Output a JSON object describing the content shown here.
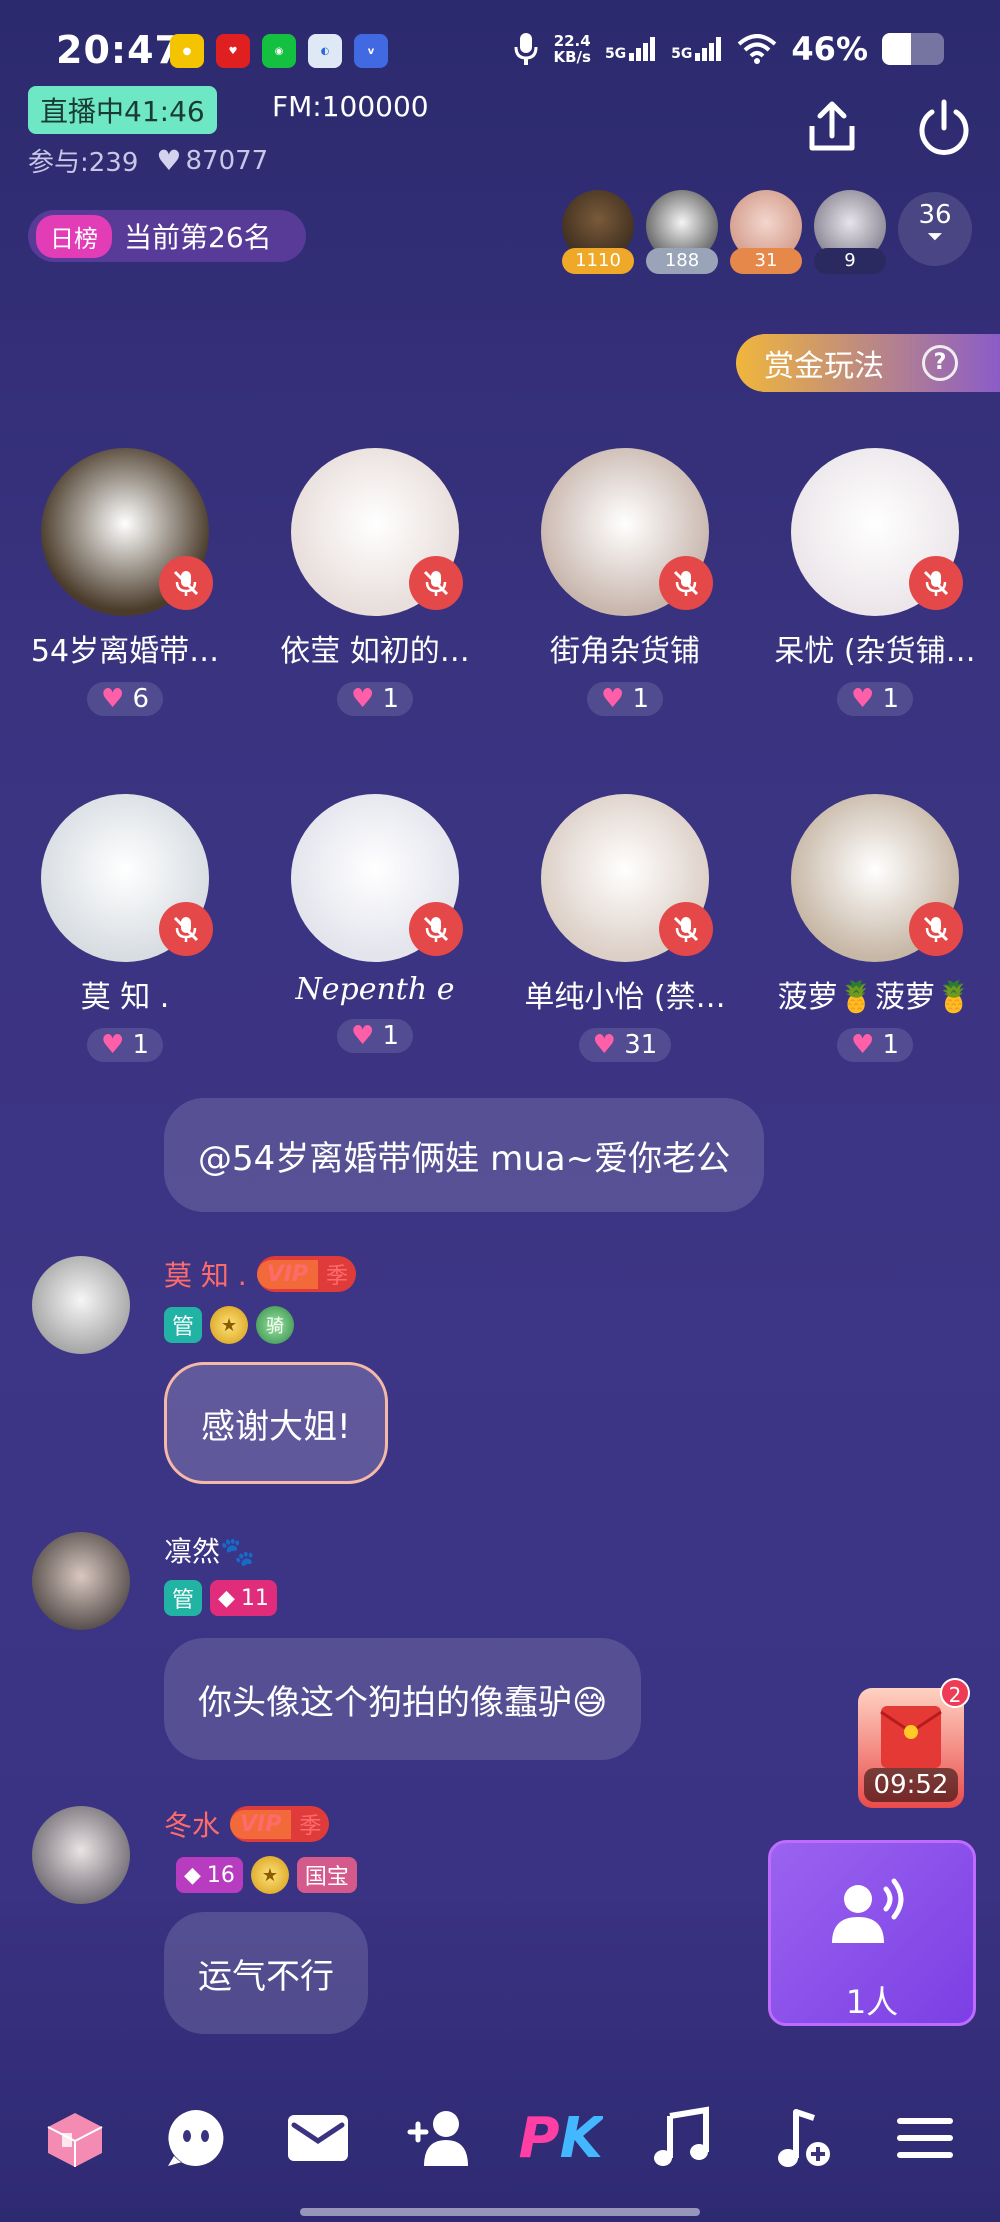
{
  "status_bar": {
    "time": "20:47",
    "net_speed_value": "22.4",
    "net_speed_unit": "KB/s",
    "sim1": "5G",
    "sim2": "5G",
    "battery": "46%",
    "battery_level": 0.46
  },
  "header": {
    "live_badge": "直播中41:46",
    "fm": "FM:100000",
    "participants": "参与:239",
    "likes": "87077",
    "rank_tag": "日榜",
    "rank_text": "当前第26名",
    "viewers": [
      {
        "badge": "1110",
        "color": "#f0a828"
      },
      {
        "badge": "188",
        "color": "#9aa4b8"
      },
      {
        "badge": "31",
        "color": "#e5884a"
      },
      {
        "badge": "9",
        "color": "#2b2a60"
      }
    ],
    "viewer_count": "36"
  },
  "bounty": {
    "label": "赏金玩法",
    "help": "?"
  },
  "seats": [
    {
      "name": "54岁离婚带…",
      "likes": "6",
      "avatar_color": "#4a3b2a"
    },
    {
      "name": "依莹 如初的…",
      "likes": "1",
      "avatar_color": "#e8dedb"
    },
    {
      "name": "街角杂货铺",
      "likes": "1",
      "avatar_color": "#c9b7ae"
    },
    {
      "name": "呆忧 (杂货铺…",
      "likes": "1",
      "avatar_color": "#ece6ea"
    },
    {
      "name": "莫 知 .",
      "likes": "1",
      "avatar_color": "#d8dde2"
    },
    {
      "name": "Nepenth e",
      "likes": "1",
      "avatar_color": "#e3e4ec"
    },
    {
      "name": "单纯小怡 (禁…",
      "likes": "31",
      "avatar_color": "#dccfc6"
    },
    {
      "name": "菠萝🍍菠萝🍍",
      "likes": "1",
      "avatar_color": "#c7b7a6"
    }
  ],
  "chat": {
    "system_message": "@54岁离婚带俩娃 mua~爱你老公",
    "messages": [
      {
        "user": "莫 知 .",
        "vip": "VIP",
        "season": "季",
        "tags": [
          "管",
          "骑"
        ],
        "text": "感谢大姐!",
        "avatar_color": "#d8dde2"
      },
      {
        "user": "凛然🐾",
        "tags": [
          "管",
          "11"
        ],
        "text": "你头像这个狗拍的像蠢驴😅",
        "avatar_color": "#6b5f5f"
      },
      {
        "user": "冬水",
        "vip": "VIP",
        "season": "季",
        "tags": [
          "16",
          "国宝"
        ],
        "text": "运气不行",
        "avatar_color": "#8f8a90"
      }
    ]
  },
  "red_packet": {
    "count": "2",
    "timer": "09:52"
  },
  "voice_card": {
    "label": "1人"
  },
  "toolbar": {
    "icons": [
      "home-3d-icon",
      "chat-face-icon",
      "mail-icon",
      "add-friend-icon",
      "pk-icon",
      "music-icon",
      "music-add-icon",
      "menu-icon"
    ],
    "pk_label": "PK"
  }
}
